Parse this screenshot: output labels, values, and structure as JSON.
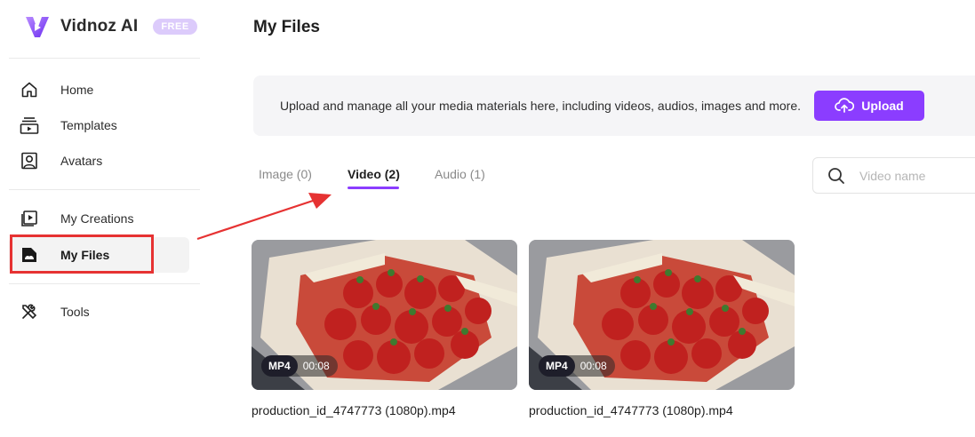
{
  "sidebar": {
    "brand": "Vidnoz AI",
    "plan_badge": "FREE",
    "items": [
      {
        "label": "Home",
        "icon": "home-icon"
      },
      {
        "label": "Templates",
        "icon": "templates-icon"
      },
      {
        "label": "Avatars",
        "icon": "avatar-icon"
      },
      {
        "label": "My Creations",
        "icon": "creations-icon"
      },
      {
        "label": "My Files",
        "icon": "files-icon",
        "active": true
      },
      {
        "label": "Tools",
        "icon": "tools-icon"
      }
    ]
  },
  "main": {
    "title": "My Files",
    "banner": {
      "text": "Upload and manage all your media materials here, including videos, audios, images and more.",
      "upload_label": "Upload"
    },
    "tabs": [
      {
        "label": "Image (0)"
      },
      {
        "label": "Video (2)",
        "active": true
      },
      {
        "label": "Audio (1)"
      }
    ],
    "search": {
      "placeholder": "Video name"
    },
    "files": [
      {
        "name": "production_id_4747773 (1080p).mp4",
        "format": "MP4",
        "duration": "00:08"
      },
      {
        "name": "production_id_4747773 (1080p).mp4",
        "format": "MP4",
        "duration": "00:08"
      }
    ]
  },
  "colors": {
    "accent": "#8b3dff",
    "highlight": "#e63232",
    "badge": "#dccbfb"
  }
}
